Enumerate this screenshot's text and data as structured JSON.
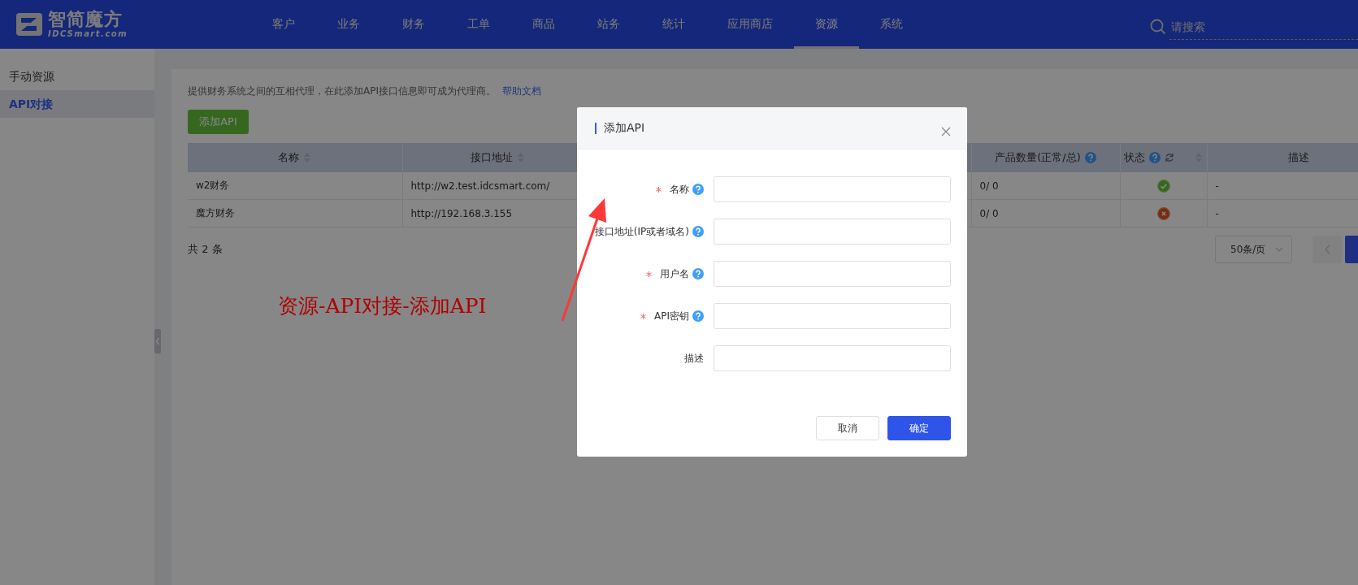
{
  "header": {
    "logo_title": "智简魔方",
    "logo_subtitle": "IDCSmart.com",
    "nav": [
      {
        "label": "客户",
        "selected": false
      },
      {
        "label": "业务",
        "selected": false
      },
      {
        "label": "财务",
        "selected": false
      },
      {
        "label": "工单",
        "selected": false
      },
      {
        "label": "商品",
        "selected": false
      },
      {
        "label": "站务",
        "selected": false
      },
      {
        "label": "统计",
        "selected": false
      },
      {
        "label": "应用商店",
        "selected": false
      },
      {
        "label": "资源",
        "selected": true
      },
      {
        "label": "系统",
        "selected": false
      }
    ],
    "search": {
      "placeholder": "请搜索"
    }
  },
  "sidebar": {
    "items": [
      {
        "label": "手动资源",
        "selected": false
      },
      {
        "label": "API对接",
        "selected": true
      }
    ]
  },
  "page": {
    "description": "提供财务系统之间的互相代理，在此添加API接口信息即可成为代理商。",
    "help_link": "帮助文档",
    "add_button": "添加API"
  },
  "table": {
    "columns": [
      {
        "label": "名称",
        "sortable": true,
        "help": false,
        "refresh": false
      },
      {
        "label": "接口地址",
        "sortable": true,
        "help": false,
        "refresh": false
      },
      {
        "label": "产品数量(正常/总)",
        "sortable": false,
        "help": true,
        "refresh": false
      },
      {
        "label": "状态",
        "sortable": true,
        "help": true,
        "refresh": true
      },
      {
        "label": "描述",
        "sortable": false,
        "help": false,
        "refresh": false
      }
    ],
    "rows": [
      {
        "name": "w2财务",
        "url": "http://w2.test.idcsmart.com/",
        "products": "0/ 0",
        "active": true,
        "description": "-"
      },
      {
        "name": "魔方财务",
        "url": "http://192.168.3.155",
        "products": "0/ 0",
        "active": false,
        "description": "-"
      }
    ]
  },
  "pagination": {
    "total": "共 2 条",
    "page_size": "50条/页"
  },
  "dialog": {
    "title": "添加API",
    "fields": [
      {
        "label": "名称",
        "required": true,
        "help": true
      },
      {
        "label": "接口地址(IP或者域名)",
        "required": false,
        "help": true
      },
      {
        "label": "用户名",
        "required": true,
        "help": true
      },
      {
        "label": "API密钥",
        "required": true,
        "help": true
      },
      {
        "label": "描述",
        "required": false,
        "help": false
      }
    ],
    "buttons": [
      {
        "label": "取消",
        "kind": "default"
      },
      {
        "label": "确定",
        "kind": "primary"
      }
    ]
  },
  "annotation": {
    "text": "资源-API对接-添加API"
  }
}
